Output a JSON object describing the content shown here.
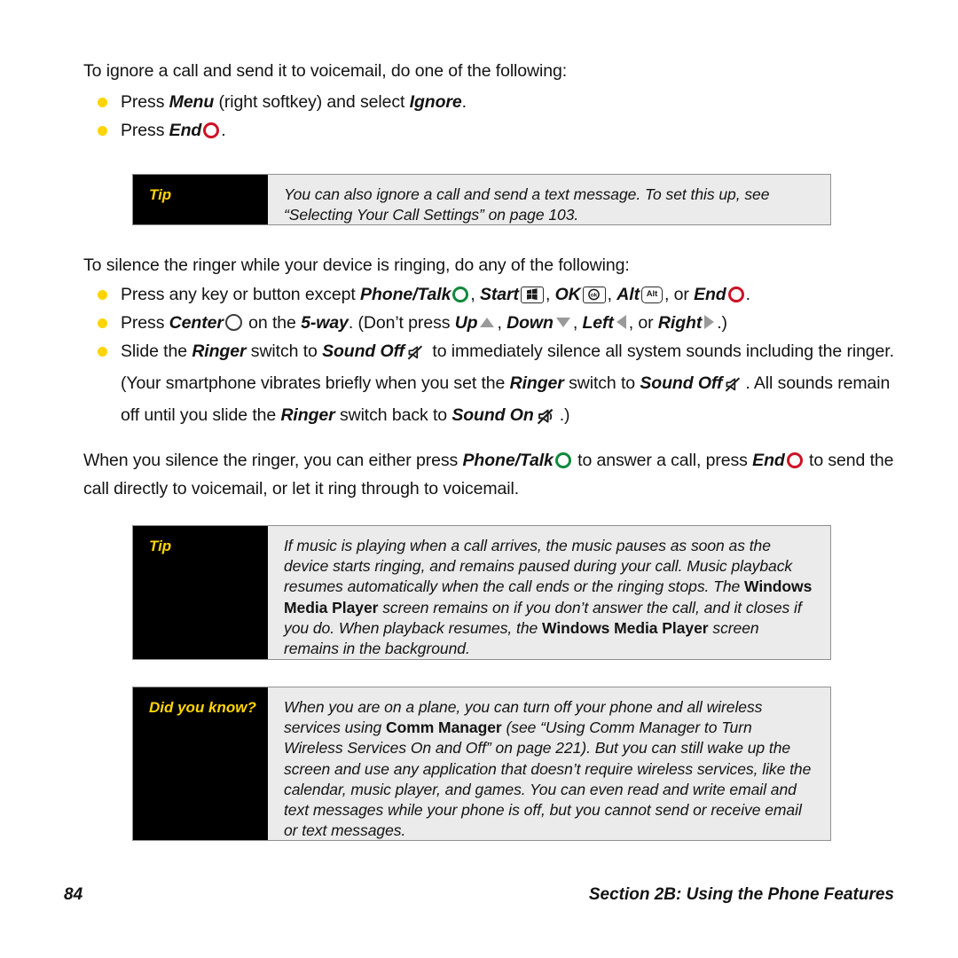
{
  "document": {
    "type": "user-manual-page",
    "colors": {
      "bullet": "#ffd400",
      "note_label_text": "#ffd400",
      "note_label_bg": "#000000",
      "note_body_bg": "#ebebeb",
      "note_border": "#8f8f8f",
      "end_key": "#cf1125",
      "phone_talk_key": "#0f8a3c",
      "nav_arrow": "#9a9a9a",
      "body_text": "#131313"
    }
  },
  "section_ignore": {
    "intro": "To ignore a call and send it to voicemail, do one of the following:",
    "bullets": [
      {
        "parts": [
          {
            "text": "Press "
          },
          {
            "text": "Menu",
            "style": "bold-italic"
          },
          {
            "text": " (right softkey) and select "
          },
          {
            "text": "Ignore",
            "style": "bold-italic"
          },
          {
            "text": "."
          }
        ]
      },
      {
        "parts": [
          {
            "text": "Press "
          },
          {
            "text": "End",
            "style": "bold-italic"
          },
          {
            "icon": "end-key-ring-icon"
          },
          {
            "text": "."
          }
        ]
      }
    ]
  },
  "tip_ignore": {
    "label": "Tip",
    "body": "You can also ignore a call and send a text message. To set this up, see “Selecting Your Call Settings” on page 103."
  },
  "section_silence": {
    "intro": "To silence the ringer while your device is ringing, do any of the following:",
    "bullets": [
      {
        "parts": [
          {
            "text": "Press any key or button except "
          },
          {
            "text": "Phone/Talk",
            "style": "bold-italic"
          },
          {
            "icon": "phone-talk-ring-icon"
          },
          {
            "text": ", "
          },
          {
            "text": "Start",
            "style": "bold-italic"
          },
          {
            "icon": "start-key-icon"
          },
          {
            "text": ", "
          },
          {
            "text": "OK",
            "style": "bold-italic"
          },
          {
            "icon": "ok-key-icon"
          },
          {
            "text": ", "
          },
          {
            "text": "Alt",
            "style": "bold-italic"
          },
          {
            "icon": "alt-key-icon"
          },
          {
            "text": ", or "
          },
          {
            "text": "End",
            "style": "bold-italic"
          },
          {
            "icon": "end-key-ring-icon"
          },
          {
            "text": "."
          }
        ]
      },
      {
        "parts": [
          {
            "text": "Press "
          },
          {
            "text": "Center",
            "style": "bold-italic"
          },
          {
            "icon": "center-key-ring-icon"
          },
          {
            "text": " on the "
          },
          {
            "text": "5-way",
            "style": "bold-italic"
          },
          {
            "text": ". (Don’t press "
          },
          {
            "text": "Up",
            "style": "bold-italic"
          },
          {
            "icon": "nav-up-icon"
          },
          {
            "text": ", "
          },
          {
            "text": "Down",
            "style": "bold-italic"
          },
          {
            "icon": "nav-down-icon"
          },
          {
            "text": ", "
          },
          {
            "text": "Left",
            "style": "bold-italic"
          },
          {
            "icon": "nav-left-icon"
          },
          {
            "text": ", or "
          },
          {
            "text": "Right",
            "style": "bold-italic"
          },
          {
            "icon": "nav-right-icon"
          },
          {
            "text": ".)"
          }
        ]
      },
      {
        "parts": [
          {
            "text": "Slide the "
          },
          {
            "text": "Ringer",
            "style": "bold-italic"
          },
          {
            "text": " switch to "
          },
          {
            "text": "Sound Off",
            "style": "bold-italic"
          },
          {
            "icon": "sound-off-icon"
          },
          {
            "text": " to immediately silence all system sounds including the ringer. (Your smartphone vibrates briefly when you set the "
          },
          {
            "text": "Ringer",
            "style": "bold-italic"
          },
          {
            "text": " switch to "
          },
          {
            "text": "Sound Off",
            "style": "bold-italic"
          },
          {
            "icon": "sound-off-icon"
          },
          {
            "text": ". All sounds remain off until you slide the "
          },
          {
            "text": "Ringer",
            "style": "bold-italic"
          },
          {
            "text": " switch back to "
          },
          {
            "text": "Sound On",
            "style": "bold-italic"
          },
          {
            "icon": "sound-on-icon"
          },
          {
            "text": ".)"
          }
        ]
      }
    ],
    "closing": {
      "parts": [
        {
          "text": "When you silence the ringer, you can either press "
        },
        {
          "text": "Phone/Talk",
          "style": "bold-italic"
        },
        {
          "icon": "phone-talk-ring-icon"
        },
        {
          "text": " to answer a call, press "
        },
        {
          "text": "End",
          "style": "bold-italic"
        },
        {
          "icon": "end-key-ring-icon"
        },
        {
          "text": " to send the call directly to voicemail, or let it ring through to voicemail."
        }
      ]
    }
  },
  "tip_music": {
    "label": "Tip",
    "body_parts": [
      {
        "text": "If music is playing when a call arrives, the music pauses as soon as the device starts ringing, and remains paused during your call. Music playback resumes automatically when the call ends or the ringing stops. The "
      },
      {
        "text": "Windows Media Player",
        "style": "bold"
      },
      {
        "text": " screen remains on if you don’t answer the call, and it closes if you do. When playback resumes, the "
      },
      {
        "text": "Windows Media Player",
        "style": "bold"
      },
      {
        "text": " screen remains in the background."
      }
    ]
  },
  "did_you_know": {
    "label": "Did you know?",
    "body_parts": [
      {
        "text": "When you are on a plane, you can turn off your phone and all wireless services using "
      },
      {
        "text": "Comm Manager",
        "style": "bold"
      },
      {
        "text": " (see “Using Comm Manager to Turn Wireless Services On and Off” on page 221). But you can still wake up the screen and use any application that doesn’t require wireless services, like the calendar, music player, and games. You can even read and write email and text messages while your phone is off, but you cannot send or receive email or text messages."
      }
    ]
  },
  "footer": {
    "page_number": "84",
    "section": "Section 2B: Using the Phone Features"
  },
  "icon_keys": {
    "start_key_label": "",
    "ok_key_label": "ok",
    "alt_key_label": "Alt"
  }
}
